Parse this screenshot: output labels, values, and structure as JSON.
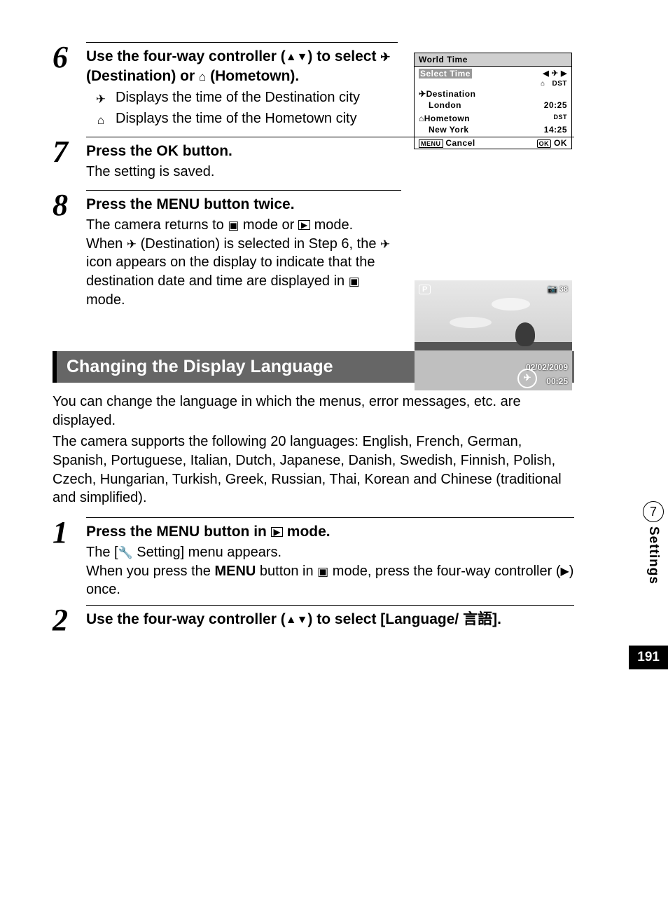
{
  "steps": {
    "s6": {
      "num": "6",
      "heading_a": "Use the four-way controller (",
      "heading_b": ") to select ",
      "heading_c": " (Destination) or ",
      "heading_d": " (Hometown).",
      "sub_dest": "Displays the time of the Destination city",
      "sub_home": "Displays the time of the Hometown city"
    },
    "s7": {
      "num": "7",
      "heading_a": "Press the ",
      "heading_b": " button.",
      "text": "The setting is saved."
    },
    "s8": {
      "num": "8",
      "heading_a": "Press the ",
      "heading_b": " button twice.",
      "text_a": "The camera returns to ",
      "text_b": " mode or ",
      "text_c": " mode.",
      "text_d": "When ",
      "text_e": " (Destination) is selected in Step 6, the ",
      "text_f": " icon appears on the display to indicate that the destination date and time are displayed in ",
      "text_g": " mode."
    }
  },
  "world_time": {
    "title": "World Time",
    "select_label": "Select Time",
    "dest_label": "Destination",
    "dest_city": "London",
    "dest_time": "20:25",
    "home_label": "Hometown",
    "home_city": "New York",
    "home_time": "14:25",
    "cancel": "Cancel",
    "ok": "OK"
  },
  "screenshot": {
    "mode": "P",
    "count": "38",
    "date": "02/02/2009",
    "time": "00:25"
  },
  "section_title": "Changing the Display Language",
  "para1": "You can change the language in which the menus, error messages, etc. are displayed.",
  "para2": "The camera supports the following 20 languages: English, French, German, Spanish, Portuguese, Italian, Dutch, Japanese, Danish, Swedish, Finnish, Polish, Czech, Hungarian, Turkish, Greek, Russian, Thai, Korean and Chinese (traditional and simplified).",
  "lang_steps": {
    "s1": {
      "num": "1",
      "heading_a": "Press the ",
      "heading_b": " button in ",
      "heading_c": " mode.",
      "text_a": "The [",
      "text_b": " Setting] menu appears.",
      "text_c": "When you press the ",
      "text_d": " button in ",
      "text_e": " mode, press the four-way controller (",
      "text_f": ") once."
    },
    "s2": {
      "num": "2",
      "heading_a": "Use the four-way controller (",
      "heading_b": ") to select [Language/ 言語]."
    }
  },
  "side": {
    "chapter": "7",
    "label": "Settings"
  },
  "page_number": "191",
  "labels": {
    "menu": "MENU",
    "ok": "OK"
  }
}
